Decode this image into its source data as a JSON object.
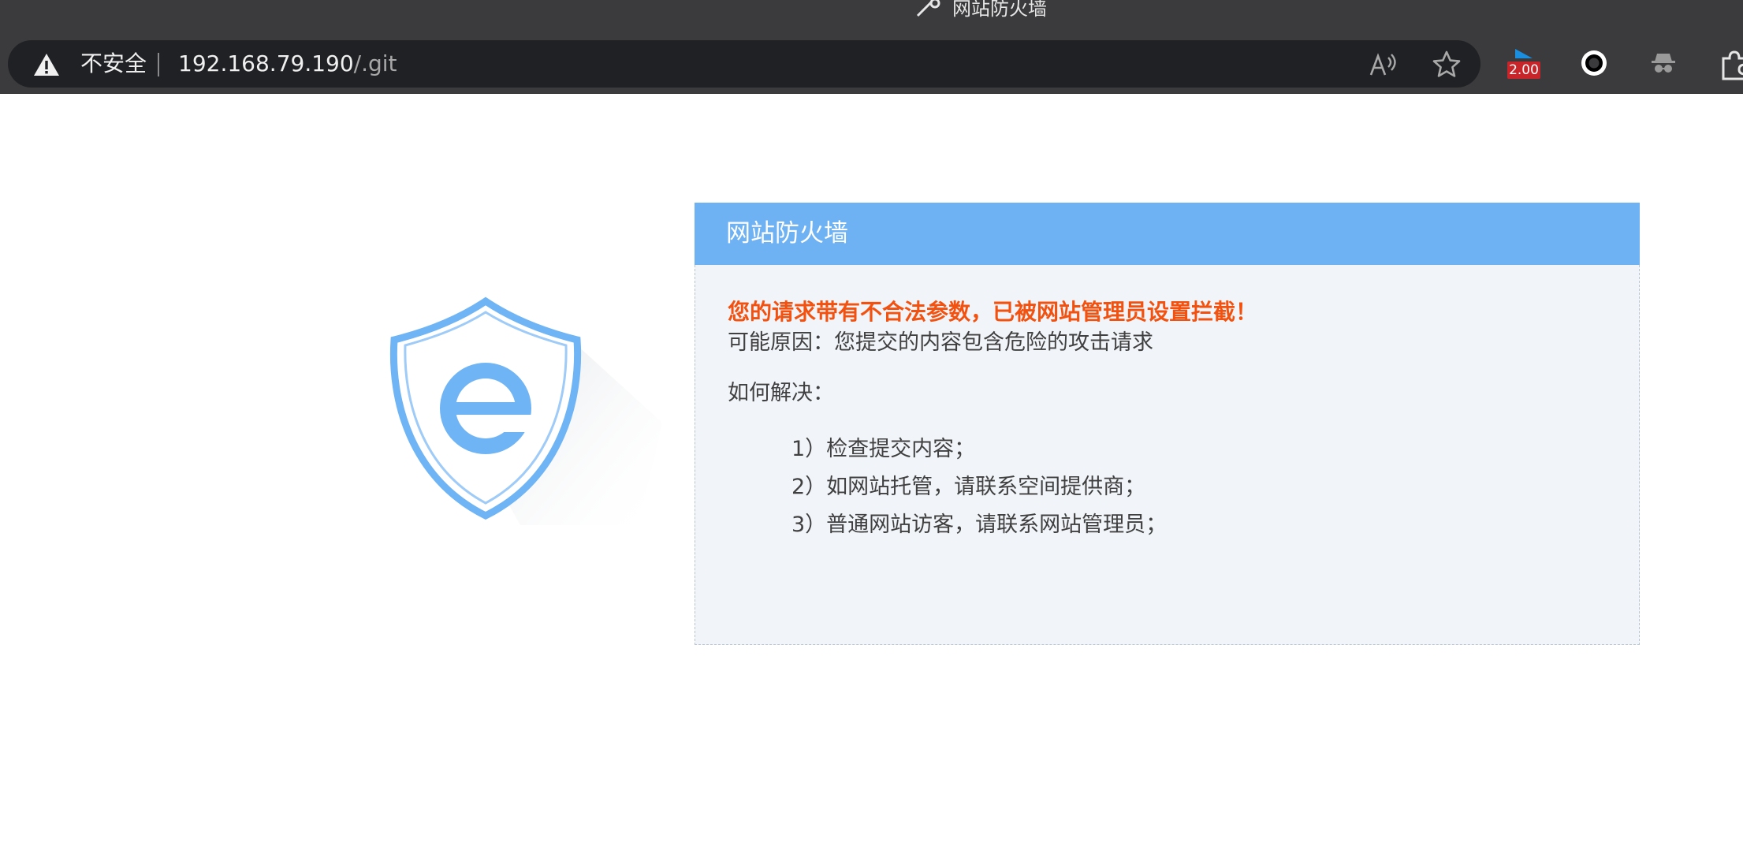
{
  "window": {
    "title": "网站防火墙"
  },
  "address_bar": {
    "security_label": "不安全",
    "url_host": "192.168.79.190",
    "url_path": "/.git"
  },
  "toolbar": {
    "extension_badge": "2.00"
  },
  "firewall": {
    "header": "网站防火墙",
    "alert": "您的请求带有不合法参数，已被网站管理员设置拦截！",
    "reason": "可能原因：您提交的内容包含危险的攻击请求",
    "how_to_solve": "如何解决：",
    "steps": [
      "1）检查提交内容；",
      "2）如网站托管，请联系空间提供商；",
      "3）普通网站访客，请联系网站管理员；"
    ]
  },
  "colors": {
    "header_blue": "#6eb2f4",
    "alert_orange": "#f2510f",
    "panel_bg": "#f1f5f9",
    "chrome_dark": "#3b3b3d"
  }
}
